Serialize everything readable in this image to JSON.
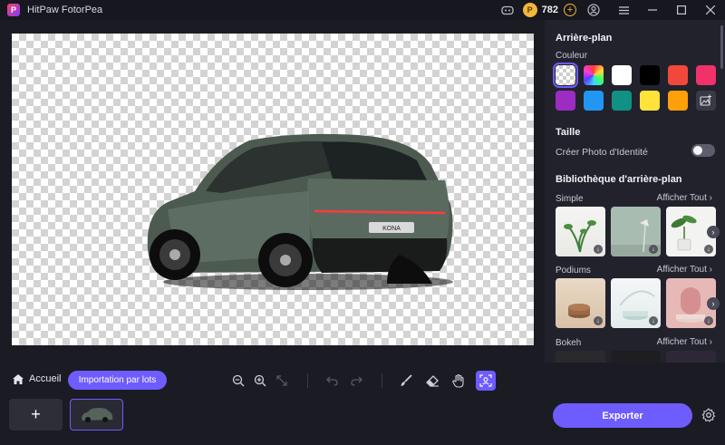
{
  "app": {
    "title": "HitPaw FotorPea",
    "coins": "782"
  },
  "panel": {
    "background_title": "Arrière-plan",
    "color_label": "Couleur",
    "swatches": [
      {
        "kind": "transparent",
        "selected": true
      },
      {
        "kind": "rainbow"
      },
      {
        "color": "#ffffff"
      },
      {
        "color": "#000000"
      },
      {
        "color": "#f2483a"
      },
      {
        "color": "#f0316a"
      },
      {
        "color": "#9c2cc2"
      },
      {
        "color": "#2196f3"
      },
      {
        "color": "#119184"
      },
      {
        "color": "#ffe33b"
      },
      {
        "color": "#ff9f0a"
      },
      {
        "kind": "add-image"
      }
    ],
    "size_title": "Taille",
    "id_photo_label": "Créer Photo d'Identité",
    "library_title": "Bibliothèque d'arrière-plan",
    "categories": [
      {
        "name": "Simple",
        "see_all": "Afficher Tout"
      },
      {
        "name": "Podiums",
        "see_all": "Afficher Tout"
      },
      {
        "name": "Bokeh",
        "see_all": "Afficher Tout"
      }
    ]
  },
  "canvas": {
    "plate_text": "KONA"
  },
  "bottom": {
    "home_label": "Accueil",
    "batch_label": "Importation par lots",
    "export_label": "Exporter"
  },
  "colors": {
    "accent": "#6e5cff",
    "panel": "#22222c",
    "bg": "#1b1b24"
  }
}
